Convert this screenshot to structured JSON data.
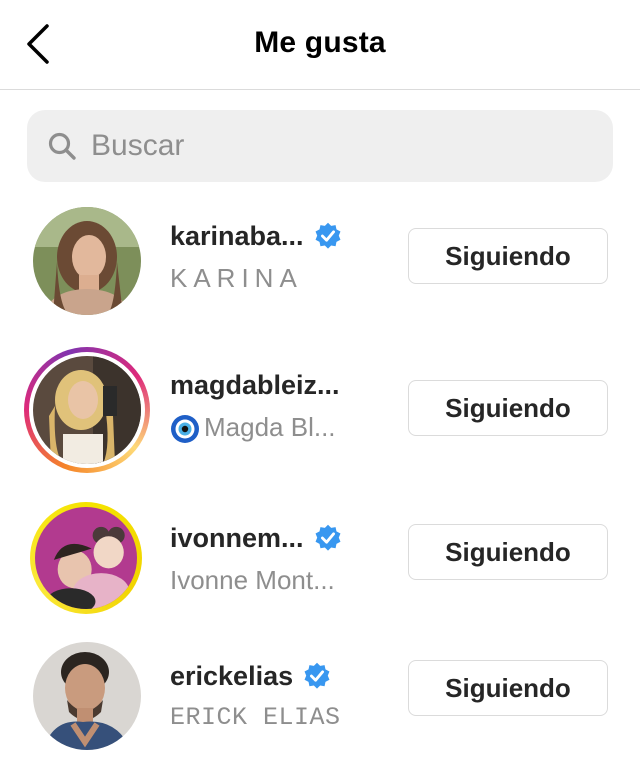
{
  "header": {
    "title": "Me gusta",
    "back_icon": "chevron-left-icon"
  },
  "search": {
    "placeholder": "Buscar",
    "value": "",
    "icon": "search-icon"
  },
  "accent": "#3897f0",
  "users": [
    {
      "username": "karinaba...",
      "full_name": "KARINA",
      "verified": true,
      "story_ring": "none",
      "button": "Siguiendo"
    },
    {
      "username": "magdableiz...",
      "full_name": "Magda Bl...",
      "name_prefix_icon": "nazar-eye-icon",
      "verified": false,
      "story_ring": "gradient",
      "button": "Siguiendo"
    },
    {
      "username": "ivonnem...",
      "full_name": "Ivonne Mont...",
      "verified": true,
      "story_ring": "yellow",
      "button": "Siguiendo"
    },
    {
      "username": "erickelias",
      "full_name": "ERICK ELIAS",
      "verified": true,
      "story_ring": "none",
      "button": "Siguiendo"
    }
  ]
}
